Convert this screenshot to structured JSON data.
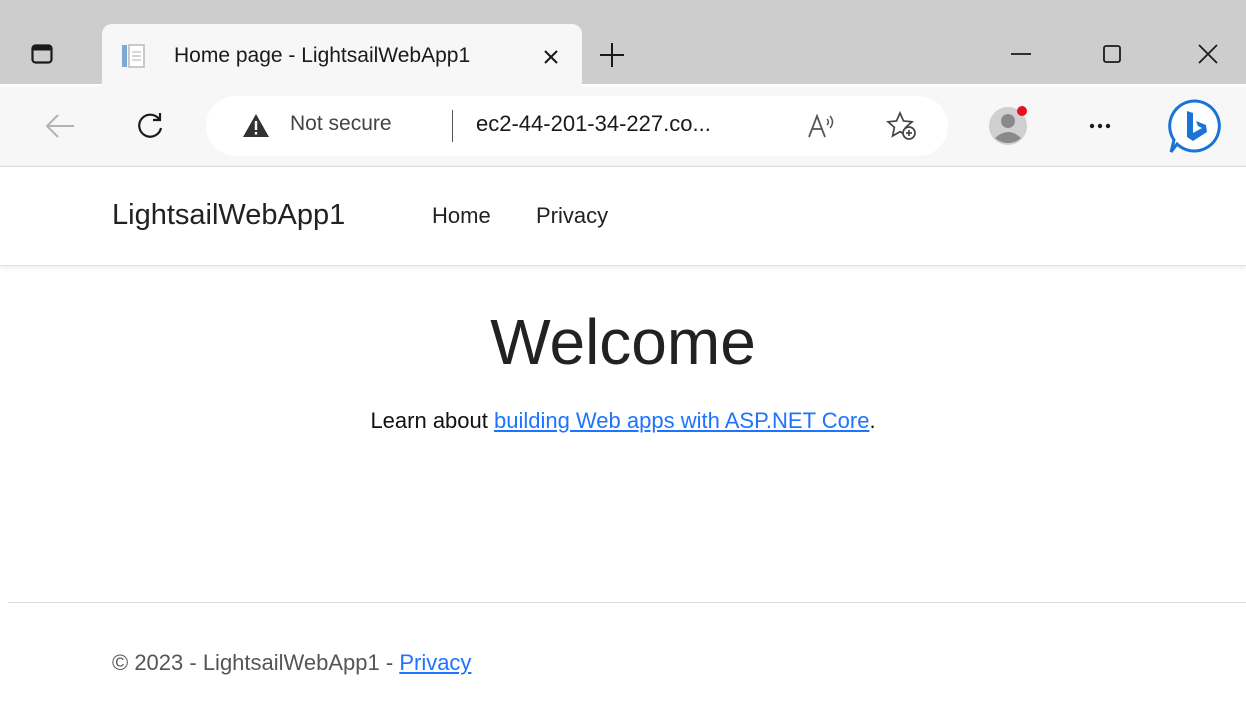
{
  "browser": {
    "tab_title": "Home page - LightsailWebApp1",
    "address_bar": {
      "security_label": "Not secure",
      "url": "ec2-44-201-34-227.co..."
    },
    "icons": {
      "tab_actions": "tab-actions-icon",
      "favicon": "page-favicon-icon",
      "close_tab": "close-icon",
      "new_tab": "plus-icon",
      "minimize": "minimize-icon",
      "maximize": "maximize-icon",
      "close_window": "close-icon",
      "back": "back-arrow-icon",
      "refresh": "refresh-icon",
      "warning": "warning-triangle-icon",
      "read_aloud": "read-aloud-icon",
      "favorites": "add-favorite-icon",
      "profile": "profile-avatar-icon",
      "more": "more-ellipsis-icon",
      "bing": "bing-chat-icon"
    },
    "accent_colors": {
      "bing_blue": "#1a73d6",
      "notification_dot": "#e81123"
    }
  },
  "site": {
    "brand": "LightsailWebApp1",
    "nav": [
      {
        "label": "Home"
      },
      {
        "label": "Privacy"
      }
    ],
    "main": {
      "heading": "Welcome",
      "learn_prefix": "Learn about ",
      "learn_link": "building Web apps with ASP.NET Core",
      "learn_suffix": "."
    },
    "footer": {
      "text": "© 2023 - LightsailWebApp1 - ",
      "privacy_link": "Privacy"
    },
    "link_color": "#1e73ff"
  }
}
